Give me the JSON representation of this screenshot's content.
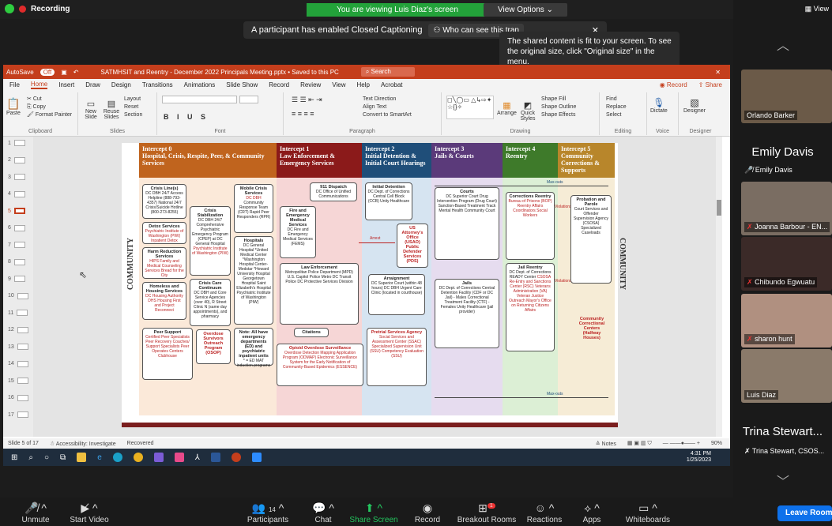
{
  "zoom_top": {
    "recording": "Recording",
    "viewing_banner": "You are viewing Luis Diaz's screen",
    "view_options": "View Options",
    "cc_banner": "A participant has enabled Closed Captioning",
    "cc_who": "Who can see this tran",
    "tooltip": "The shared content is fit to your screen. To see the original size, click \"Original size\" in the menu."
  },
  "ppt": {
    "autosave": "AutoSave",
    "toggle": "Off",
    "filename": "SATMHSIT and Reentry - December 2022 Principals Meeting.pptx • Saved to this PC",
    "search": "Search",
    "menu": [
      "File",
      "Home",
      "Insert",
      "Draw",
      "Design",
      "Transitions",
      "Animations",
      "Slide Show",
      "Record",
      "Review",
      "View",
      "Help",
      "Acrobat"
    ],
    "record_btn": "Record",
    "share_btn": "Share",
    "ribbon_groups": [
      "Clipboard",
      "Slides",
      "Font",
      "Paragraph",
      "Drawing",
      "Editing",
      "Voice",
      "Designer"
    ],
    "ribbon_items": {
      "paste": "Paste",
      "cut": "Cut",
      "copy": "Copy",
      "format_painter": "Format Painter",
      "new_slide": "New Slide",
      "reuse": "Reuse Slides",
      "layout": "Layout",
      "reset": "Reset",
      "section": "Section",
      "text_direction": "Text Direction",
      "align_text": "Align Text",
      "smartart": "Convert to SmartArt",
      "arrange": "Arrange",
      "quick_styles": "Quick Styles",
      "shape_fill": "Shape Fill",
      "shape_outline": "Shape Outline",
      "shape_effects": "Shape Effects",
      "find": "Find",
      "replace": "Replace",
      "select": "Select",
      "dictate": "Dictate",
      "designer": "Designer"
    },
    "slide_numbers": [
      "1",
      "2",
      "3",
      "4",
      "5",
      "6",
      "7",
      "8",
      "9",
      "10",
      "11",
      "12",
      "13",
      "14",
      "15",
      "16",
      "17"
    ],
    "status": {
      "slide": "Slide 5 of 17",
      "accessibility": "Accessibility: Investigate",
      "recovered": "Recovered",
      "notes": "Notes",
      "zoom": "90%"
    }
  },
  "slide": {
    "side_left": "COMMUNITY",
    "side_right": "COMMUNITY",
    "headers": [
      {
        "title": "Intercept 0",
        "sub": "Hospital, Crisis, Respite, Peer, & Community Services",
        "color": "#c0641e"
      },
      {
        "title": "Intercept 1",
        "sub": "Law Enforcement & Emergency Services",
        "color": "#8b1a1a"
      },
      {
        "title": "Intercept 2",
        "sub": "Initial Detention & Initial Court Hearings",
        "color": "#1f4e79"
      },
      {
        "title": "Intercept 3",
        "sub": "Jails & Courts",
        "color": "#5b3a7a"
      },
      {
        "title": "Intercept 4",
        "sub": "Reentry",
        "color": "#3e7a2a"
      },
      {
        "title": "Intercept 5",
        "sub": "Community Corrections & Supports",
        "color": "#b8862b"
      }
    ],
    "boxes": {
      "crisis_lines": {
        "title": "Crisis Line(s)",
        "body": "DC DBH 24/7 Access Helpline (888-793-4357) National 24/7 Crisis/Suicide Hotline (800-273-8255)"
      },
      "crisis_stab": {
        "title": "Crisis Stabilization",
        "body": "DC DBH 24/7 Comprehensive Psychiatric Emergency Program (CPEP) at DC General Hospital",
        "red": "Psychiatric Institute of Washington (PIW)"
      },
      "mobile_crisis": {
        "title": "Mobile Crisis Services",
        "red": "DC DBH",
        "body": "Community Response Team (CRT) Rapid Peer Responders (RPR)"
      },
      "detox": {
        "title": "Detox Services",
        "red": "Psychiatric Institute of Washington (PIW) Inpatient Detox"
      },
      "harm": {
        "title": "Harm Reduction Services",
        "red": "HIPS Family and Medical Counseling Services Bread for the City"
      },
      "crisis_care": {
        "title": "Crisis Care Continuum",
        "body": "DC DBH and Core Service Agencies (over 40), R Street Clinic N (same day appointments), and pharmacy"
      },
      "homeless": {
        "title": "Homeless and Housing Services",
        "red": "DC Housing Authority DHS Housing First and Project Reconnect"
      },
      "hospitals": {
        "title": "Hospitals",
        "body": "DC General Hospital *United Medical Center *Washington Hospital Center- Medstar *Howard University Hospital Georgetown Hospital Saint Elizabeth's Hospital Psychiatric Institute of Washington (PIW)"
      },
      "note": {
        "title": "Note: All have emergency departments (ED) and psychiatric inpatient units",
        "body": "* = ED MAT induction programs"
      },
      "peer": {
        "title": "Peer Support",
        "red": "Certified Peer Specialists Peer Recovery Coaches/ Support Specialists Peer Operates Centers Clubhouse"
      },
      "overdose": {
        "title": "Overdose Survivors Outreach Program (OSOP)"
      },
      "dispatch": {
        "title": "911 Dispatch",
        "body": "DC Office of Unified Communications"
      },
      "fire": {
        "title": "Fire and Emergency Medical Services",
        "body": "DC Fire and Emergency Medical Services (FEMS)"
      },
      "law": {
        "title": "Law Enforcement",
        "body": "Metropolitan Police Department (MPD) U.S. Capitol Police Metro DC Transit Police DC Protective Services Division"
      },
      "citations": {
        "title": "Citations"
      },
      "ods": {
        "title": "Opioid Overdose Surveillance",
        "red": "Overdose Detection Mapping Application Program (ODMAP) Electronic Surveillance System for the Early Notification of Community-Based Epidemics (ESSENCE)"
      },
      "initial_det": {
        "title": "Initial Detention",
        "body": "DC Dept. of Corrections Central Cell Block (CCB) Unity Healthcare"
      },
      "usao": {
        "title": "US Attorney's Office (USAO) Public Defender Services (PDS)"
      },
      "arraign": {
        "title": "Arraignment",
        "body": "DC Superior Court (within 48 hours) DC DBH Urgent Care Clinic (located in courthouse)"
      },
      "pretrial": {
        "title": "Pretrial Services Agency",
        "red": "Social Services and Assessment Center (SSAC) Specialized Supervision Unit (SSU) Competency Evaluation (SSU)"
      },
      "courts": {
        "title": "Courts",
        "body": "DC Superior Court Drug Intervention Program (Drug Court) Sanction-Based Treatment Track Mental Health Community Court"
      },
      "jails": {
        "title": "Jails",
        "body": "DC Dept. of Corrections Central Detention Facility (CDF or DC Jail) - Males Correctional Treatment Facility (CTF) - Females Unity Healthcare (jail provider)"
      },
      "corr_reentry": {
        "title": "Corrections Reentry",
        "red": "Bureau of Prisons (BOP) Reentry Affairs Coordinators Social Workers"
      },
      "jail_reentry": {
        "title": "Jail Reentry",
        "body": "DC Dept. of Corrections READY Center",
        "red": "CSOSA Re-Entry and Sanctions Center (RSC) Veterans Administration (VA) Veteran Justice Outreach Mayor's Office on Returning Citizens Affairs"
      },
      "probation": {
        "title": "Probation and Parole",
        "body": "Court Services and Offender Supervision Agency (CSOSA) Specialized Caseloads"
      },
      "ccc": {
        "title": "Community Correctional Centers (Halfway Houses)"
      }
    },
    "labels": {
      "arrest": "Arrest",
      "violations": "Violations",
      "violations2": "Violations",
      "maxouts": "Max-outs",
      "maxouts2": "Max-outs"
    }
  },
  "taskbar": {
    "time": "4:31 PM",
    "date": "1/25/2023"
  },
  "panel": {
    "view": "View",
    "participants": [
      {
        "name": "Orlando Barker"
      },
      {
        "name": "Joanna Barbour - EN..."
      },
      {
        "name": "Chibundo Egwuatu"
      },
      {
        "name": "sharon hunt"
      },
      {
        "name": "Luis Diaz"
      },
      {
        "name": "Trina Stewart, CSOS..."
      }
    ],
    "emily_big": "Emily Davis",
    "emily_small": "Emily Davis",
    "trina_big": "Trina Stewart..."
  },
  "zoom_bottom": {
    "unmute": "Unmute",
    "start_video": "Start Video",
    "participants": "Participants",
    "participants_count": "14",
    "chat": "Chat",
    "share": "Share Screen",
    "record": "Record",
    "breakout": "Breakout Rooms",
    "breakout_badge": "1",
    "reactions": "Reactions",
    "apps": "Apps",
    "whiteboards": "Whiteboards",
    "leave": "Leave Room"
  }
}
